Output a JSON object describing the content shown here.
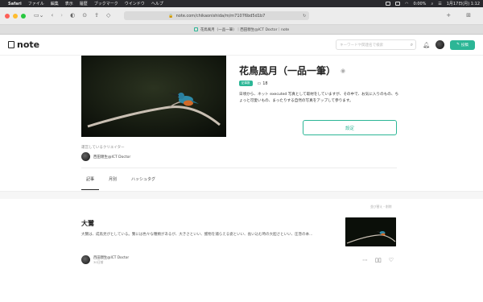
{
  "menubar": {
    "app": "Safari",
    "items": [
      "ファイル",
      "編集",
      "表示",
      "履歴",
      "ブックマーク",
      "ウインドウ",
      "ヘルプ"
    ],
    "battery": "0:00%",
    "datetime": "1月17日(月) 1:12"
  },
  "browser": {
    "url": "note.com/chikaonishida/m/m71076bd5d1b7",
    "tab_title": "花鳥風月（一品一筆）｜西田親生@ICT Doctor｜note"
  },
  "site": {
    "logo": "note",
    "search_placeholder": "キーワードや関連名で検索",
    "post_button": "投稿",
    "post_icon": "pencil-icon"
  },
  "magazine": {
    "title": "花鳥風月（一品一筆）",
    "badge": "記事数",
    "article_count": "18",
    "description": "日頃から、ネット executed 写真として取材をしていますが、その中で、お気に入りのもの、ちょっと可愛いもの、まったりする自然の写真をアップして参ります。",
    "settings_button": "設定",
    "creator_label": "運営しているクリエイター",
    "creator_name": "西田親生@ICT Doctor"
  },
  "tabs": [
    {
      "label": "記事",
      "active": true
    },
    {
      "label": "月別",
      "active": false
    },
    {
      "label": "ハッシュタグ",
      "active": false
    }
  ],
  "sort_link": "並び替え・削除",
  "article": {
    "title": "大鷺",
    "body": "大鷺は、成鳥見がとしている。鷺には色々な種類があるが、大きさといい、獲物を捕らえる姿といい、長い込む時の大胆さといい、圧巻の本...",
    "author": "西田親生@ICT Doctor",
    "date": "30日前"
  },
  "colors": {
    "accent": "#2cb696",
    "menubar": "#2a2a2e",
    "toolbar": "#ececec"
  }
}
